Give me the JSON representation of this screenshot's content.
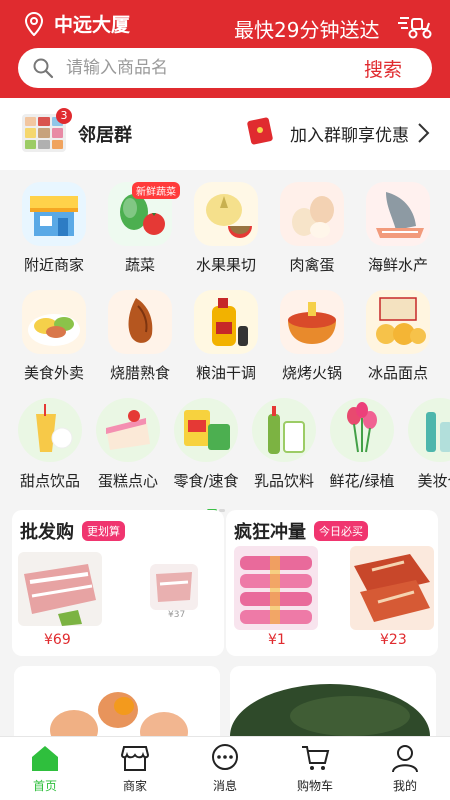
{
  "header": {
    "location": "中远大厦",
    "delivery_text": "最快29分钟送达",
    "search_placeholder": "请输入商品名",
    "search_button": "搜索",
    "brand_color": "#e02b2f"
  },
  "group": {
    "name": "邻居群",
    "badge_count": "3",
    "join_text": "加入群聊享优惠"
  },
  "categories": [
    {
      "label": "附近商家",
      "icon": "store-icon"
    },
    {
      "label": "蔬菜",
      "icon": "vegetable-icon",
      "tag": "新鲜蔬菜"
    },
    {
      "label": "水果果切",
      "icon": "fruit-icon"
    },
    {
      "label": "肉禽蛋",
      "icon": "meat-egg-icon"
    },
    {
      "label": "海鲜水产",
      "icon": "seafood-icon"
    },
    {
      "label": "美食外卖",
      "icon": "takeout-icon"
    },
    {
      "label": "烧腊熟食",
      "icon": "roast-duck-icon"
    },
    {
      "label": "粮油干调",
      "icon": "oil-grain-icon"
    },
    {
      "label": "烧烤火锅",
      "icon": "hotpot-icon"
    },
    {
      "label": "冰品面点",
      "icon": "pastry-icon"
    },
    {
      "label": "甜点饮品",
      "icon": "drink-icon"
    },
    {
      "label": "蛋糕点心",
      "icon": "cake-icon"
    },
    {
      "label": "零食/速食",
      "icon": "snack-icon"
    },
    {
      "label": "乳品饮料",
      "icon": "milk-icon"
    },
    {
      "label": "鲜花/绿植",
      "icon": "flower-icon"
    },
    {
      "label": "美妆个",
      "icon": "cosmetics-icon"
    }
  ],
  "promos": [
    {
      "title": "批发购",
      "tag": "更划算",
      "products": [
        {
          "price": "¥69",
          "icon": "pork-icon"
        },
        {
          "price": "¥37",
          "icon": "meat-slice-icon"
        }
      ]
    },
    {
      "title": "疯狂冲量",
      "tag": "今日必买",
      "products": [
        {
          "price": "¥1",
          "icon": "sausage-icon"
        },
        {
          "price": "¥23",
          "icon": "roast-pork-icon"
        }
      ]
    }
  ],
  "feed": [
    {
      "icon": "eggs-icon"
    },
    {
      "icon": "avocado-icon"
    }
  ],
  "tabbar": {
    "active_color": "#2fbf3d",
    "tabs": [
      {
        "label": "首页",
        "icon": "home-icon"
      },
      {
        "label": "商家",
        "icon": "shop-icon"
      },
      {
        "label": "消息",
        "icon": "message-icon"
      },
      {
        "label": "购物车",
        "icon": "cart-icon"
      },
      {
        "label": "我的",
        "icon": "profile-icon"
      }
    ]
  }
}
